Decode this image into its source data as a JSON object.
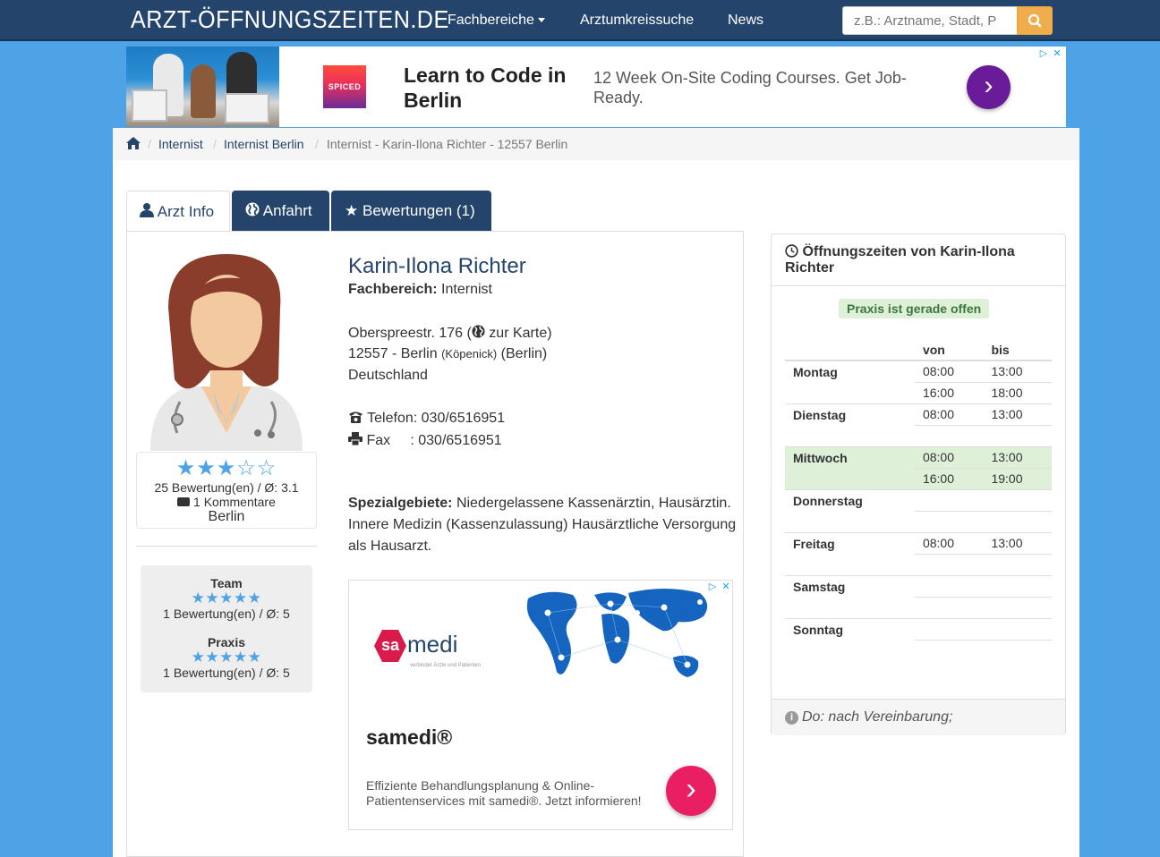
{
  "navbar": {
    "brand": "ARZT-ÖFFNUNGSZEITEN.DE",
    "menu": [
      "Fachbereiche",
      "Arztumkreissuche",
      "News"
    ],
    "search_placeholder": "z.B.: Arztname, Stadt, P"
  },
  "top_ad": {
    "logo_text": "SPICED",
    "headline": "Learn to Code in Berlin",
    "description": "12 Week On-Site Coding Courses. Get Job-Ready.",
    "arrow": "›"
  },
  "breadcrumb": {
    "items": [
      "Internist",
      "Internist Berlin"
    ],
    "active": "Internist - Karin-Ilona Richter - 12557 Berlin",
    "sep": "/"
  },
  "tabs": {
    "info": "Arzt Info",
    "route": "Anfahrt",
    "reviews": "Bewertungen (1)"
  },
  "rating": {
    "stars_filled": 3,
    "stars_total": 5,
    "stars_display": "★★★☆☆",
    "summary": "25 Bewertung(en) / Ø: 3.1",
    "comments": "1 Kommentare",
    "city": "Berlin"
  },
  "subratings": [
    {
      "title": "Team",
      "stars": "★★★★★",
      "summary": "1 Bewertung(en) / Ø: 5"
    },
    {
      "title": "Praxis",
      "stars": "★★★★★",
      "summary": "1 Bewertung(en) / Ø: 5"
    }
  ],
  "doctor": {
    "name": "Karin-Ilona Richter",
    "field_label": "Fachbereich:",
    "field": "Internist",
    "street": "Oberspreestr. 176 (",
    "map_link": "zur Karte",
    "street_close": ")",
    "city_line": "12557 - Berlin",
    "district": "(Köpenick)",
    "state": "(Berlin)",
    "country": "Deutschland",
    "phone_label": "Telefon:",
    "phone": "030/6516951",
    "fax_label": "Fax",
    "fax": ": 030/6516951",
    "spec_label": "Spezialgebiete:",
    "spec": "Niedergelassene Kassenärztin, Hausärztin. Innere Medizin (Kassenzulassung) Hausärztliche Versorgung als Hausarzt."
  },
  "mid_ad": {
    "logo_sa": "sa",
    "logo_medi": "medi",
    "logo_sub": "verbindet Ärzte und Patienten",
    "title": "samedi®",
    "description": "Effiziente Behandlungsplanung & Online-Patientenservices mit samedi®. Jetzt informieren!",
    "arrow": "›"
  },
  "hours": {
    "heading": "Öffnungszeiten von Karin-Ilona Richter",
    "status": "Praxis ist gerade offen",
    "col_from": "von",
    "col_to": "bis",
    "days": [
      {
        "day": "Montag",
        "slots": [
          [
            "08:00",
            "13:00"
          ],
          [
            "16:00",
            "18:00"
          ]
        ]
      },
      {
        "day": "Dienstag",
        "slots": [
          [
            "08:00",
            "13:00"
          ],
          [
            "",
            ""
          ]
        ]
      },
      {
        "day": "Mittwoch",
        "slots": [
          [
            "08:00",
            "13:00"
          ],
          [
            "16:00",
            "19:00"
          ]
        ],
        "today": true
      },
      {
        "day": "Donnerstag",
        "slots": [
          [
            "",
            ""
          ],
          [
            "",
            ""
          ]
        ]
      },
      {
        "day": "Freitag",
        "slots": [
          [
            "08:00",
            "13:00"
          ],
          [
            "",
            ""
          ]
        ]
      },
      {
        "day": "Samstag",
        "slots": [
          [
            "",
            ""
          ],
          [
            "",
            ""
          ]
        ]
      },
      {
        "day": "Sonntag",
        "slots": [
          [
            "",
            ""
          ],
          [
            "",
            ""
          ]
        ]
      }
    ],
    "footer_note": "Do: nach Vereinbarung;"
  },
  "colors": {
    "navbar": "#24446b",
    "background": "#4da3e6",
    "accent_star": "#4da3e6",
    "search_button": "#f0ad4e",
    "open_badge": "#dff0d8"
  }
}
